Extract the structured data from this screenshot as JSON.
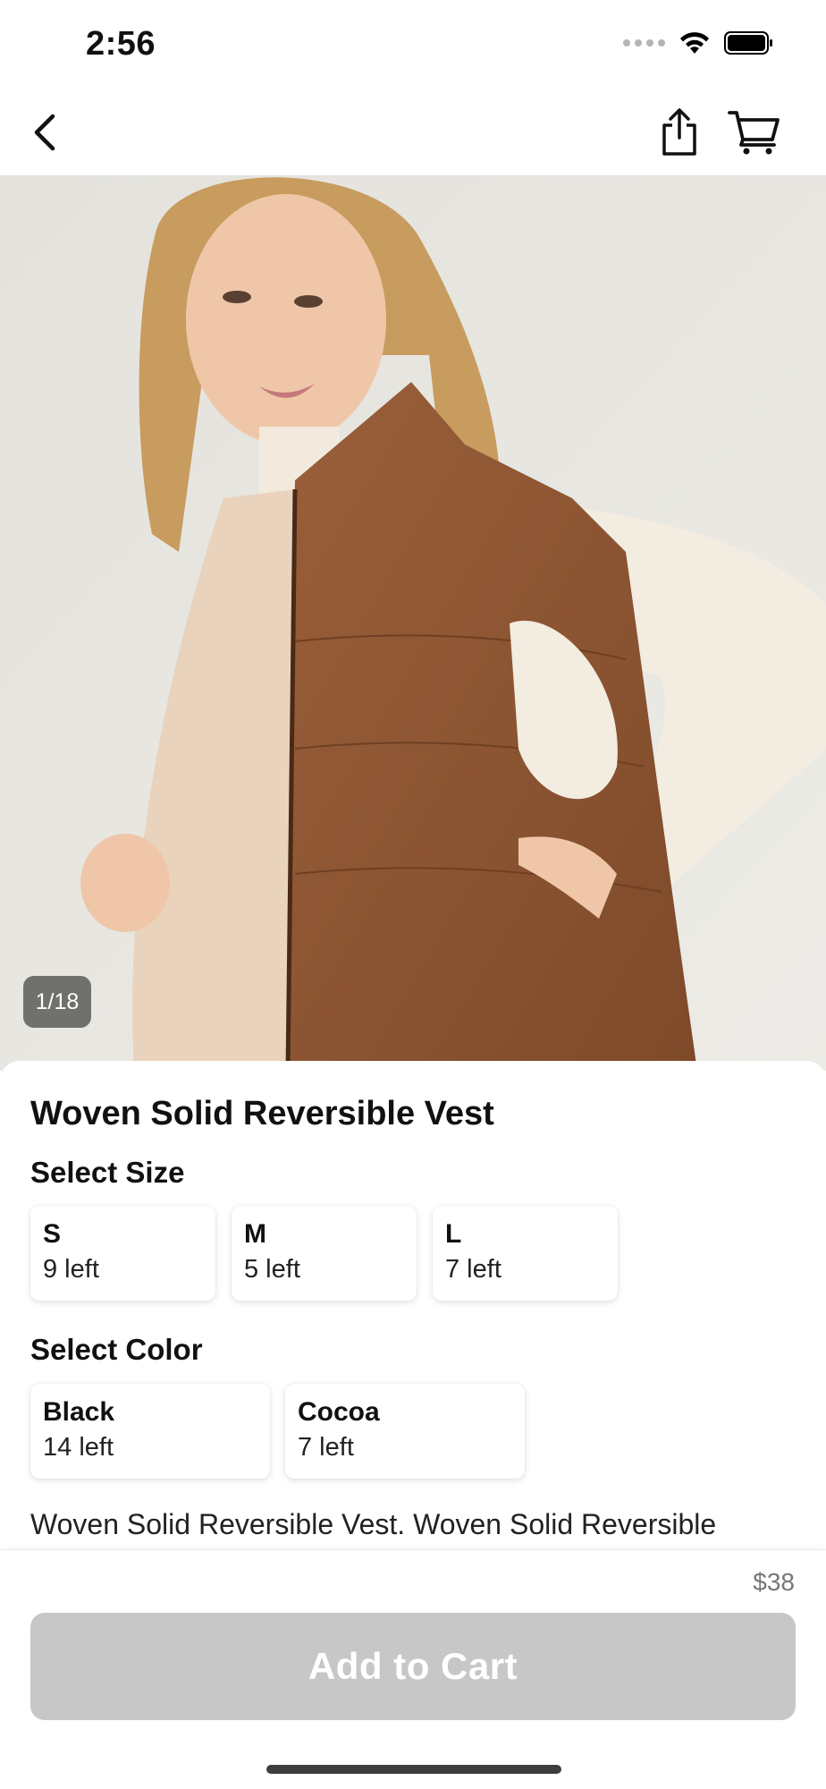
{
  "status_bar": {
    "time": "2:56"
  },
  "nav": {
    "back_icon": "chevron-left-icon",
    "share_icon": "share-icon",
    "cart_icon": "cart-icon"
  },
  "gallery": {
    "counter": "1/18"
  },
  "product": {
    "title": "Woven Solid Reversible Vest",
    "description": "Woven Solid Reversible Vest. Woven Solid Reversible"
  },
  "size_section": {
    "title": "Select Size",
    "options": [
      {
        "name": "S",
        "stock": "9 left"
      },
      {
        "name": "M",
        "stock": "5 left"
      },
      {
        "name": "L",
        "stock": "7 left"
      }
    ]
  },
  "color_section": {
    "title": "Select Color",
    "options": [
      {
        "name": "Black",
        "stock": "14 left"
      },
      {
        "name": "Cocoa",
        "stock": "7 left"
      }
    ]
  },
  "checkout": {
    "price": "$38",
    "add_to_cart_label": "Add to Cart",
    "button_color": "#c7c7c7"
  }
}
